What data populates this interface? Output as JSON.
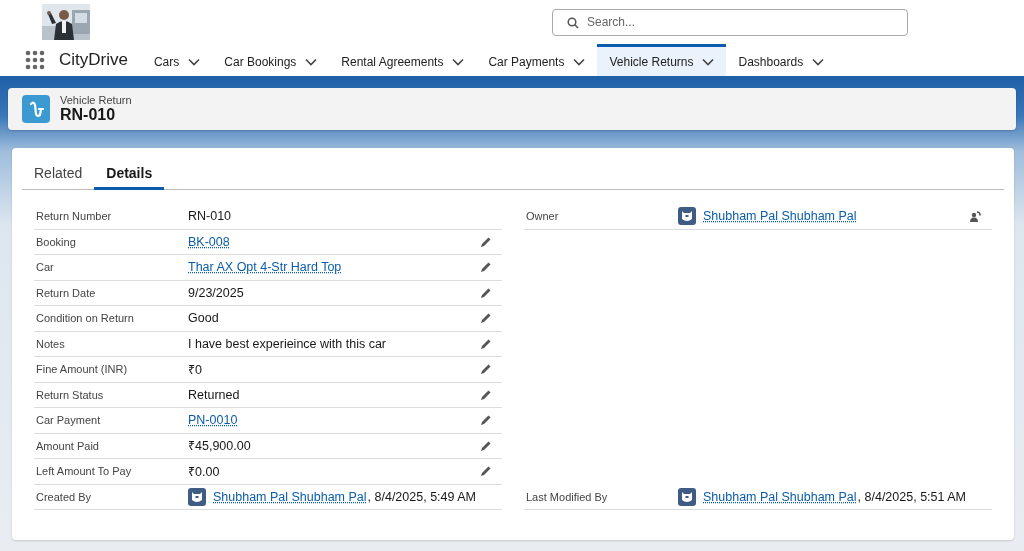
{
  "header": {
    "search": {
      "placeholder": "Search..."
    }
  },
  "nav": {
    "app_name": "CityDrive",
    "items": [
      {
        "label": "Cars",
        "selected": false
      },
      {
        "label": "Car Bookings",
        "selected": false
      },
      {
        "label": "Rental Agreements",
        "selected": false
      },
      {
        "label": "Car Payments",
        "selected": false
      },
      {
        "label": "Vehicle Returns",
        "selected": true
      },
      {
        "label": "Dashboards",
        "selected": false
      }
    ]
  },
  "record": {
    "object_label": "Vehicle Return",
    "title": "RN-010"
  },
  "tabs": [
    {
      "label": "Related",
      "selected": false
    },
    {
      "label": "Details",
      "selected": true
    }
  ],
  "details": {
    "left": [
      {
        "label": "Return Number",
        "kind": "text",
        "value": "RN-010",
        "editable": false
      },
      {
        "label": "Booking",
        "kind": "link",
        "value": "BK-008",
        "editable": true
      },
      {
        "label": "Car",
        "kind": "link",
        "value": "Thar AX Opt 4-Str Hard Top",
        "editable": true
      },
      {
        "label": "Return Date",
        "kind": "text",
        "value": "9/23/2025",
        "editable": true
      },
      {
        "label": "Condition on Return",
        "kind": "text",
        "value": "Good",
        "editable": true
      },
      {
        "label": "Notes",
        "kind": "text",
        "value": "I have best experieince with this car",
        "editable": true
      },
      {
        "label": "Fine Amount (INR)",
        "kind": "text",
        "value": "₹0",
        "editable": true
      },
      {
        "label": "Return Status",
        "kind": "text",
        "value": "Returned",
        "editable": true
      },
      {
        "label": "Car Payment",
        "kind": "link",
        "value": "PN-0010",
        "editable": true
      },
      {
        "label": "Amount Paid",
        "kind": "text",
        "value": "₹45,900.00",
        "editable": true
      },
      {
        "label": "Left Amount To Pay",
        "kind": "text",
        "value": "₹0.00",
        "editable": true
      }
    ],
    "right": [
      {
        "label": "Owner",
        "kind": "owner",
        "value": "Shubham Pal Shubham Pal",
        "editable": false
      }
    ],
    "system": [
      {
        "label": "Created By",
        "kind": "user",
        "value": "Shubham Pal Shubham Pal",
        "suffix": ", 8/4/2025, 5:49 AM",
        "editable": false
      },
      {
        "label": "Last Modified By",
        "kind": "user",
        "value": "Shubham Pal Shubham Pal",
        "suffix": ", 8/4/2025, 5:51 AM",
        "editable": false
      }
    ]
  }
}
